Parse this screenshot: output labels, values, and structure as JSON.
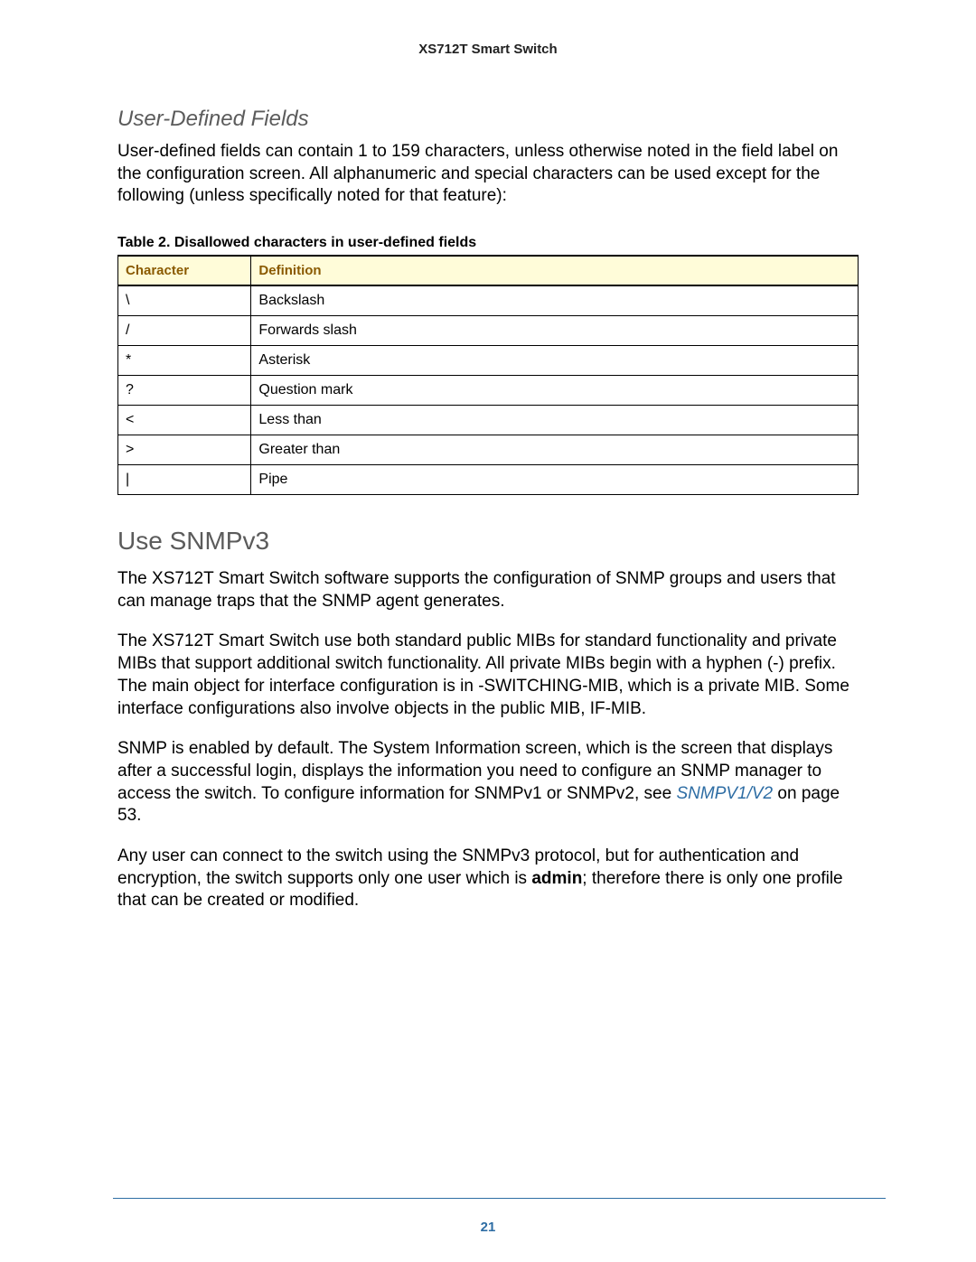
{
  "running_header": "XS712T Smart Switch",
  "section1": {
    "title": "User-Defined Fields",
    "paragraph": "User-defined fields can contain 1 to 159 characters, unless otherwise noted in the field label on the configuration screen. All alphanumeric and special characters can be used except for the following (unless specifically noted for that feature):"
  },
  "table": {
    "caption": "Table 2.  Disallowed characters in user-defined fields",
    "headers": {
      "col1": "Character",
      "col2": "Definition"
    },
    "rows": [
      {
        "char": "\\",
        "def": "Backslash"
      },
      {
        "char": "/",
        "def": "Forwards slash"
      },
      {
        "char": "*",
        "def": "Asterisk"
      },
      {
        "char": "?",
        "def": "Question mark"
      },
      {
        "char": "<",
        "def": "Less than"
      },
      {
        "char": ">",
        "def": "Greater than"
      },
      {
        "char": "|",
        "def": "Pipe"
      }
    ]
  },
  "section2": {
    "title": "Use SNMPv3",
    "p1": "The XS712T Smart Switch software supports the configuration of SNMP groups and users that can manage traps that the SNMP agent generates.",
    "p2": "The XS712T Smart Switch use both standard public MIBs for standard functionality and private MIBs that support additional switch functionality. All private MIBs begin with a hyphen (-) prefix. The main object for interface configuration is in -SWITCHING-MIB, which is a private MIB. Some interface configurations also involve objects in the public MIB, IF-MIB.",
    "p3_a": "SNMP is enabled by default. The System Information screen, which is the screen that displays after a successful login, displays the information you need to configure an SNMP manager to access the switch. To configure information for SNMPv1 or SNMPv2, see ",
    "p3_link": "SNMPV1/V2",
    "p3_b": " on page 53.",
    "p4_a": "Any user can connect to the switch using the SNMPv3 protocol, but for authentication and encryption, the switch supports only one user which is ",
    "p4_bold": "admin",
    "p4_b": "; therefore there is only one profile that can be created or modified."
  },
  "page_number": "21"
}
